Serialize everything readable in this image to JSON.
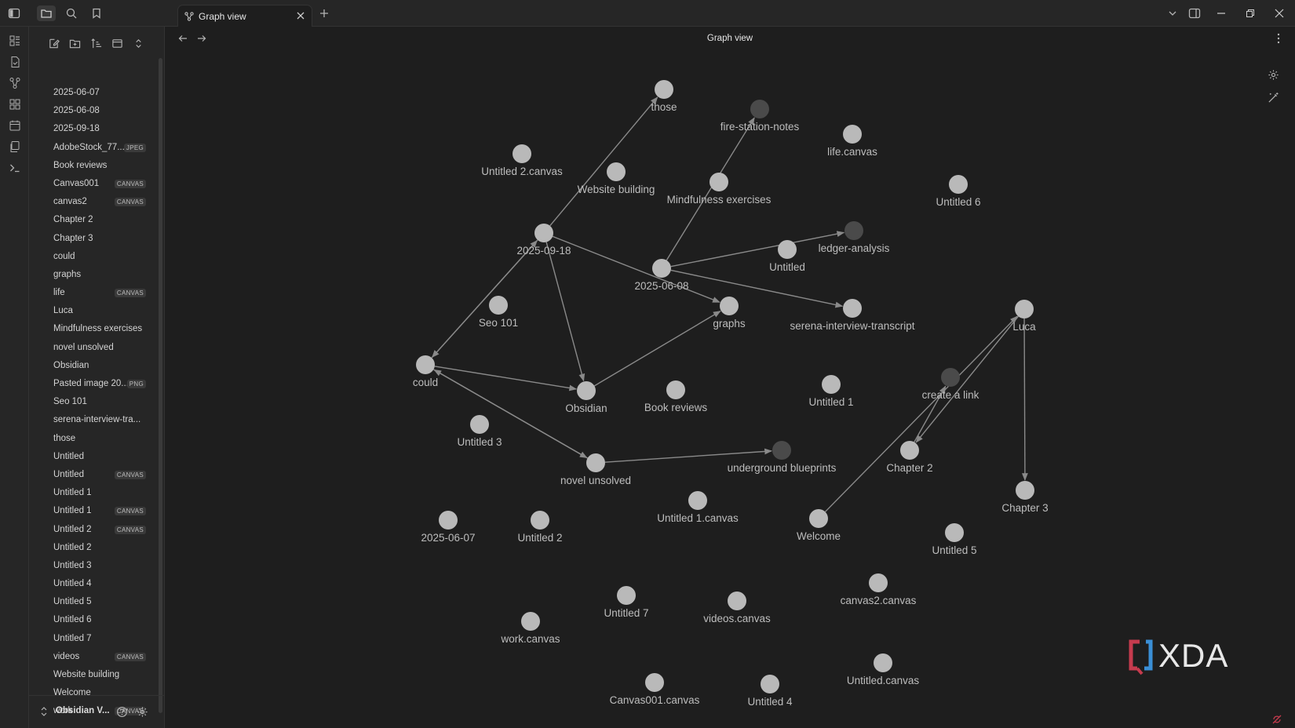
{
  "tab": {
    "title": "Graph view"
  },
  "view": {
    "title": "Graph view"
  },
  "vault": {
    "name": "Obsidian V..."
  },
  "files": [
    {
      "name": "2025-06-07",
      "badge": ""
    },
    {
      "name": "2025-06-08",
      "badge": ""
    },
    {
      "name": "2025-09-18",
      "badge": ""
    },
    {
      "name": "AdobeStock_77...",
      "badge": "JPEG"
    },
    {
      "name": "Book reviews",
      "badge": ""
    },
    {
      "name": "Canvas001",
      "badge": "CANVAS"
    },
    {
      "name": "canvas2",
      "badge": "CANVAS"
    },
    {
      "name": "Chapter 2",
      "badge": ""
    },
    {
      "name": "Chapter 3",
      "badge": ""
    },
    {
      "name": "could",
      "badge": ""
    },
    {
      "name": "graphs",
      "badge": ""
    },
    {
      "name": "life",
      "badge": "CANVAS"
    },
    {
      "name": "Luca",
      "badge": ""
    },
    {
      "name": "Mindfulness exercises",
      "badge": ""
    },
    {
      "name": "novel unsolved",
      "badge": ""
    },
    {
      "name": "Obsidian",
      "badge": ""
    },
    {
      "name": "Pasted image 20...",
      "badge": "PNG"
    },
    {
      "name": "Seo 101",
      "badge": ""
    },
    {
      "name": "serena-interview-tra...",
      "badge": ""
    },
    {
      "name": "those",
      "badge": ""
    },
    {
      "name": "Untitled",
      "badge": ""
    },
    {
      "name": "Untitled",
      "badge": "CANVAS"
    },
    {
      "name": "Untitled 1",
      "badge": ""
    },
    {
      "name": "Untitled 1",
      "badge": "CANVAS"
    },
    {
      "name": "Untitled 2",
      "badge": "CANVAS"
    },
    {
      "name": "Untitled 2",
      "badge": ""
    },
    {
      "name": "Untitled 3",
      "badge": ""
    },
    {
      "name": "Untitled 4",
      "badge": ""
    },
    {
      "name": "Untitled 5",
      "badge": ""
    },
    {
      "name": "Untitled 6",
      "badge": ""
    },
    {
      "name": "Untitled 7",
      "badge": ""
    },
    {
      "name": "videos",
      "badge": "CANVAS"
    },
    {
      "name": "Website building",
      "badge": ""
    },
    {
      "name": "Welcome",
      "badge": ""
    },
    {
      "name": "work",
      "badge": "CANVAS"
    }
  ],
  "graph": {
    "nodes": [
      {
        "id": "those",
        "label": "those",
        "unresolved": false
      },
      {
        "id": "fire-station-notes",
        "label": "fire-station-notes",
        "unresolved": true
      },
      {
        "id": "life-canvas",
        "label": "life.canvas",
        "unresolved": false
      },
      {
        "id": "untitled2-canvas",
        "label": "Untitled 2.canvas",
        "unresolved": false
      },
      {
        "id": "website-building",
        "label": "Website building",
        "unresolved": false
      },
      {
        "id": "mindfulness",
        "label": "Mindfulness exercises",
        "unresolved": false
      },
      {
        "id": "untitled6",
        "label": "Untitled 6",
        "unresolved": false
      },
      {
        "id": "ledger",
        "label": "ledger-analysis",
        "unresolved": true
      },
      {
        "id": "d20250918",
        "label": "2025-09-18",
        "unresolved": false
      },
      {
        "id": "untitled",
        "label": "Untitled",
        "unresolved": false
      },
      {
        "id": "d20250608",
        "label": "2025-06-08",
        "unresolved": false
      },
      {
        "id": "seo101",
        "label": "Seo 101",
        "unresolved": false
      },
      {
        "id": "graphs",
        "label": "graphs",
        "unresolved": false
      },
      {
        "id": "serena",
        "label": "serena-interview-transcript",
        "unresolved": false
      },
      {
        "id": "luca",
        "label": "Luca",
        "unresolved": false
      },
      {
        "id": "could",
        "label": "could",
        "unresolved": false
      },
      {
        "id": "obsidian",
        "label": "Obsidian",
        "unresolved": false
      },
      {
        "id": "book-reviews",
        "label": "Book reviews",
        "unresolved": false
      },
      {
        "id": "untitled1",
        "label": "Untitled 1",
        "unresolved": false
      },
      {
        "id": "create-link",
        "label": "create a link",
        "unresolved": true
      },
      {
        "id": "untitled3",
        "label": "Untitled 3",
        "unresolved": false
      },
      {
        "id": "novel",
        "label": "novel unsolved",
        "unresolved": false
      },
      {
        "id": "underground",
        "label": "underground blueprints",
        "unresolved": true
      },
      {
        "id": "chapter2",
        "label": "Chapter 2",
        "unresolved": false
      },
      {
        "id": "chapter3",
        "label": "Chapter 3",
        "unresolved": false
      },
      {
        "id": "untitled1-canvas",
        "label": "Untitled 1.canvas",
        "unresolved": false
      },
      {
        "id": "d20250607",
        "label": "2025-06-07",
        "unresolved": false
      },
      {
        "id": "untitled2",
        "label": "Untitled 2",
        "unresolved": false
      },
      {
        "id": "welcome",
        "label": "Welcome",
        "unresolved": false
      },
      {
        "id": "untitled5",
        "label": "Untitled 5",
        "unresolved": false
      },
      {
        "id": "canvas2-canvas",
        "label": "canvas2.canvas",
        "unresolved": false
      },
      {
        "id": "untitled7",
        "label": "Untitled 7",
        "unresolved": false
      },
      {
        "id": "videos-canvas",
        "label": "videos.canvas",
        "unresolved": false
      },
      {
        "id": "work-canvas",
        "label": "work.canvas",
        "unresolved": false
      },
      {
        "id": "untitled-canvas",
        "label": "Untitled.canvas",
        "unresolved": false
      },
      {
        "id": "canvas001-canvas",
        "label": "Canvas001.canvas",
        "unresolved": false
      },
      {
        "id": "untitled4",
        "label": "Untitled 4",
        "unresolved": false
      }
    ],
    "edges": [
      {
        "from": "d20250918",
        "to": "those"
      },
      {
        "from": "d20250918",
        "to": "could"
      },
      {
        "from": "d20250918",
        "to": "obsidian"
      },
      {
        "from": "d20250918",
        "to": "graphs"
      },
      {
        "from": "d20250608",
        "to": "fire-station-notes"
      },
      {
        "from": "d20250608",
        "to": "ledger"
      },
      {
        "from": "d20250608",
        "to": "serena"
      },
      {
        "from": "could",
        "to": "d20250918"
      },
      {
        "from": "could",
        "to": "obsidian"
      },
      {
        "from": "could",
        "to": "novel"
      },
      {
        "from": "novel",
        "to": "could"
      },
      {
        "from": "obsidian",
        "to": "graphs"
      },
      {
        "from": "novel",
        "to": "underground"
      },
      {
        "from": "welcome",
        "to": "luca"
      },
      {
        "from": "luca",
        "to": "chapter2"
      },
      {
        "from": "chapter2",
        "to": "create-link"
      },
      {
        "from": "luca",
        "to": "chapter3"
      }
    ]
  },
  "colors": {
    "node": "#b9b9b9",
    "unresolved_node": "#4a4a4a",
    "edge": "#8a8a8a",
    "xda_bracket": "#c63b4e",
    "xda_text": "#e8e8e8"
  },
  "watermark": {
    "text": "XDA"
  }
}
